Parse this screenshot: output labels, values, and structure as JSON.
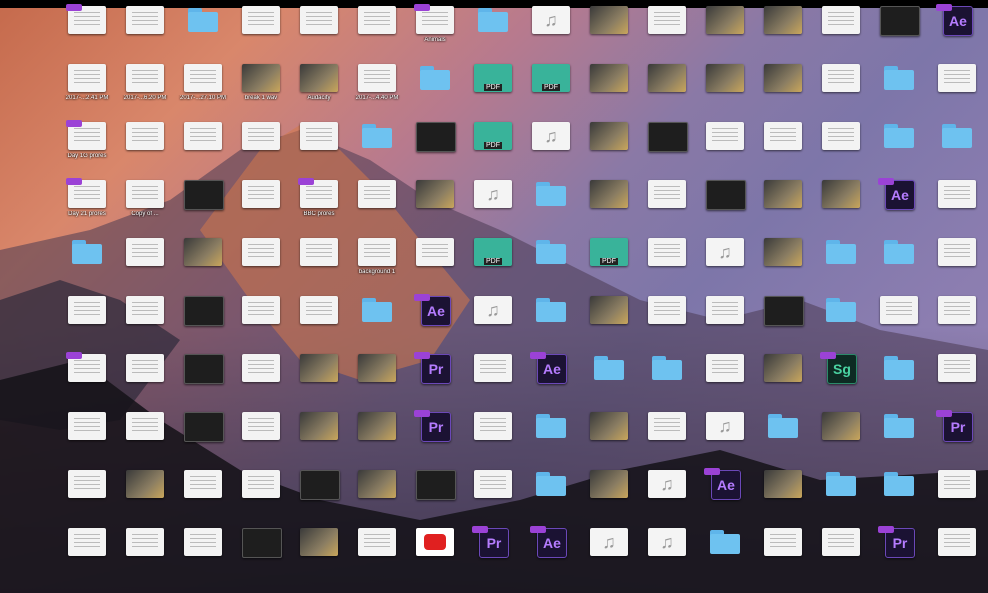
{
  "desktop": {
    "items": [
      {
        "label": "",
        "kind": "doc",
        "tag": true
      },
      {
        "label": "",
        "kind": "doc"
      },
      {
        "label": "",
        "kind": "folder"
      },
      {
        "label": "",
        "kind": "doc"
      },
      {
        "label": "",
        "kind": "doc"
      },
      {
        "label": "",
        "kind": "doc"
      },
      {
        "label": "Animals",
        "kind": "doc",
        "tag": true
      },
      {
        "label": "",
        "kind": "folder"
      },
      {
        "label": "",
        "kind": "audio"
      },
      {
        "label": "",
        "kind": "img"
      },
      {
        "label": "",
        "kind": "doc"
      },
      {
        "label": "",
        "kind": "img"
      },
      {
        "label": "",
        "kind": "img"
      },
      {
        "label": "",
        "kind": "doc"
      },
      {
        "label": "",
        "kind": "dark"
      },
      {
        "label": "Ae",
        "kind": "ae",
        "tag": true
      },
      {
        "label": "2017-...2.41 PM",
        "kind": "doc"
      },
      {
        "label": "2017-...6.20 PM",
        "kind": "doc"
      },
      {
        "label": "2017-...27.10 PM",
        "kind": "doc"
      },
      {
        "label": "break 1 wav",
        "kind": "img"
      },
      {
        "label": "Audacity",
        "kind": "img"
      },
      {
        "label": "2017-...4.40 PM",
        "kind": "doc"
      },
      {
        "label": "",
        "kind": "folder"
      },
      {
        "label": "",
        "kind": "pdf"
      },
      {
        "label": "",
        "kind": "pdf"
      },
      {
        "label": "",
        "kind": "img"
      },
      {
        "label": "",
        "kind": "img"
      },
      {
        "label": "",
        "kind": "img"
      },
      {
        "label": "",
        "kind": "img"
      },
      {
        "label": "",
        "kind": "doc"
      },
      {
        "label": "",
        "kind": "folder"
      },
      {
        "label": "",
        "kind": "doc"
      },
      {
        "label": "Day 1G prores",
        "kind": "doc",
        "tag": true
      },
      {
        "label": "",
        "kind": "doc"
      },
      {
        "label": "",
        "kind": "doc"
      },
      {
        "label": "",
        "kind": "doc"
      },
      {
        "label": "",
        "kind": "doc"
      },
      {
        "label": "",
        "kind": "folder"
      },
      {
        "label": "",
        "kind": "dark"
      },
      {
        "label": "",
        "kind": "pdf"
      },
      {
        "label": "",
        "kind": "audio"
      },
      {
        "label": "",
        "kind": "img"
      },
      {
        "label": "",
        "kind": "dark"
      },
      {
        "label": "",
        "kind": "doc"
      },
      {
        "label": "",
        "kind": "doc"
      },
      {
        "label": "",
        "kind": "doc"
      },
      {
        "label": "",
        "kind": "folder"
      },
      {
        "label": "",
        "kind": "folder"
      },
      {
        "label": "Day 21 prores",
        "kind": "doc",
        "tag": true
      },
      {
        "label": "Copy of ...",
        "kind": "doc"
      },
      {
        "label": "",
        "kind": "dark"
      },
      {
        "label": "",
        "kind": "doc"
      },
      {
        "label": "BBC prores",
        "kind": "doc",
        "tag": true
      },
      {
        "label": "",
        "kind": "doc"
      },
      {
        "label": "",
        "kind": "img"
      },
      {
        "label": "",
        "kind": "audio"
      },
      {
        "label": "",
        "kind": "folder"
      },
      {
        "label": "",
        "kind": "img"
      },
      {
        "label": "",
        "kind": "doc"
      },
      {
        "label": "",
        "kind": "dark"
      },
      {
        "label": "",
        "kind": "img"
      },
      {
        "label": "",
        "kind": "img"
      },
      {
        "label": "Ae",
        "kind": "ae",
        "tag": true
      },
      {
        "label": "",
        "kind": "doc"
      },
      {
        "label": "",
        "kind": "folder"
      },
      {
        "label": "",
        "kind": "doc"
      },
      {
        "label": "",
        "kind": "img"
      },
      {
        "label": "",
        "kind": "doc"
      },
      {
        "label": "",
        "kind": "doc"
      },
      {
        "label": "background 1",
        "kind": "doc"
      },
      {
        "label": "",
        "kind": "doc"
      },
      {
        "label": "",
        "kind": "pdf"
      },
      {
        "label": "",
        "kind": "folder"
      },
      {
        "label": "",
        "kind": "pdf"
      },
      {
        "label": "",
        "kind": "doc"
      },
      {
        "label": "",
        "kind": "audio"
      },
      {
        "label": "",
        "kind": "img"
      },
      {
        "label": "",
        "kind": "folder"
      },
      {
        "label": "",
        "kind": "folder"
      },
      {
        "label": "",
        "kind": "doc"
      },
      {
        "label": "",
        "kind": "doc"
      },
      {
        "label": "",
        "kind": "doc"
      },
      {
        "label": "",
        "kind": "dark"
      },
      {
        "label": "",
        "kind": "doc"
      },
      {
        "label": "",
        "kind": "doc"
      },
      {
        "label": "",
        "kind": "folder"
      },
      {
        "label": "Ae",
        "kind": "ae",
        "tag": true
      },
      {
        "label": "",
        "kind": "audio"
      },
      {
        "label": "",
        "kind": "folder"
      },
      {
        "label": "",
        "kind": "img"
      },
      {
        "label": "",
        "kind": "doc"
      },
      {
        "label": "",
        "kind": "doc"
      },
      {
        "label": "",
        "kind": "dark"
      },
      {
        "label": "",
        "kind": "folder"
      },
      {
        "label": "",
        "kind": "doc"
      },
      {
        "label": "",
        "kind": "doc"
      },
      {
        "label": "",
        "kind": "doc",
        "tag": true
      },
      {
        "label": "",
        "kind": "doc"
      },
      {
        "label": "",
        "kind": "dark"
      },
      {
        "label": "",
        "kind": "doc"
      },
      {
        "label": "",
        "kind": "img"
      },
      {
        "label": "",
        "kind": "img"
      },
      {
        "label": "Pr",
        "kind": "pr",
        "tag": true
      },
      {
        "label": "",
        "kind": "doc"
      },
      {
        "label": "Ae",
        "kind": "ae",
        "tag": true
      },
      {
        "label": "",
        "kind": "folder"
      },
      {
        "label": "",
        "kind": "folder"
      },
      {
        "label": "",
        "kind": "doc"
      },
      {
        "label": "",
        "kind": "img"
      },
      {
        "label": "Sg",
        "kind": "sg",
        "tag": true
      },
      {
        "label": "",
        "kind": "folder"
      },
      {
        "label": "",
        "kind": "doc"
      },
      {
        "label": "",
        "kind": "doc"
      },
      {
        "label": "",
        "kind": "doc"
      },
      {
        "label": "",
        "kind": "dark"
      },
      {
        "label": "",
        "kind": "doc"
      },
      {
        "label": "",
        "kind": "img"
      },
      {
        "label": "",
        "kind": "img"
      },
      {
        "label": "Pr",
        "kind": "pr",
        "tag": true
      },
      {
        "label": "",
        "kind": "doc"
      },
      {
        "label": "",
        "kind": "folder"
      },
      {
        "label": "",
        "kind": "img"
      },
      {
        "label": "",
        "kind": "doc"
      },
      {
        "label": "",
        "kind": "audio"
      },
      {
        "label": "",
        "kind": "folder"
      },
      {
        "label": "",
        "kind": "img"
      },
      {
        "label": "",
        "kind": "folder"
      },
      {
        "label": "Pr",
        "kind": "pr",
        "tag": true
      },
      {
        "label": "",
        "kind": "doc"
      },
      {
        "label": "",
        "kind": "img"
      },
      {
        "label": "",
        "kind": "doc"
      },
      {
        "label": "",
        "kind": "doc"
      },
      {
        "label": "",
        "kind": "dark"
      },
      {
        "label": "",
        "kind": "img"
      },
      {
        "label": "",
        "kind": "dark"
      },
      {
        "label": "",
        "kind": "doc"
      },
      {
        "label": "",
        "kind": "folder"
      },
      {
        "label": "",
        "kind": "img"
      },
      {
        "label": "",
        "kind": "audio"
      },
      {
        "label": "Ae",
        "kind": "ae",
        "tag": true
      },
      {
        "label": "",
        "kind": "img"
      },
      {
        "label": "",
        "kind": "folder"
      },
      {
        "label": "",
        "kind": "folder"
      },
      {
        "label": "",
        "kind": "doc"
      },
      {
        "label": "",
        "kind": "doc"
      },
      {
        "label": "",
        "kind": "doc"
      },
      {
        "label": "",
        "kind": "doc"
      },
      {
        "label": "",
        "kind": "dark"
      },
      {
        "label": "",
        "kind": "img"
      },
      {
        "label": "",
        "kind": "doc"
      },
      {
        "label": "",
        "kind": "yt"
      },
      {
        "label": "Pr",
        "kind": "pr",
        "tag": true
      },
      {
        "label": "Ae",
        "kind": "ae",
        "tag": true
      },
      {
        "label": "",
        "kind": "audio"
      },
      {
        "label": "",
        "kind": "audio"
      },
      {
        "label": "",
        "kind": "folder"
      },
      {
        "label": "",
        "kind": "doc"
      },
      {
        "label": "",
        "kind": "doc"
      },
      {
        "label": "Pr",
        "kind": "pr",
        "tag": true
      },
      {
        "label": "",
        "kind": "doc"
      }
    ]
  }
}
